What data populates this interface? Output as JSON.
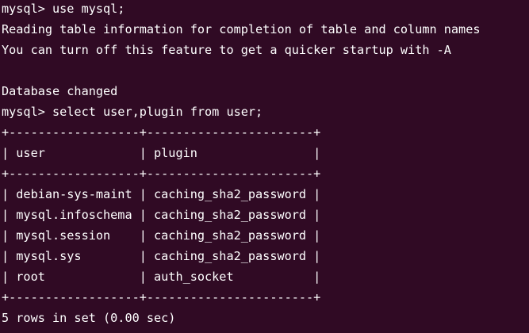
{
  "theme": {
    "background": "#300a24",
    "foreground": "#ffffff"
  },
  "terminal": {
    "lines": [
      "mysql> use mysql;",
      "Reading table information for completion of table and column names",
      "You can turn off this feature to get a quicker startup with -A",
      "",
      "Database changed",
      "mysql> select user,plugin from user;",
      "+------------------+-----------------------+",
      "| user             | plugin                |",
      "+------------------+-----------------------+",
      "| debian-sys-maint | caching_sha2_password |",
      "| mysql.infoschema | caching_sha2_password |",
      "| mysql.session    | caching_sha2_password |",
      "| mysql.sys        | caching_sha2_password |",
      "| root             | auth_socket           |",
      "+------------------+-----------------------+",
      "5 rows in set (0.00 sec)"
    ]
  }
}
